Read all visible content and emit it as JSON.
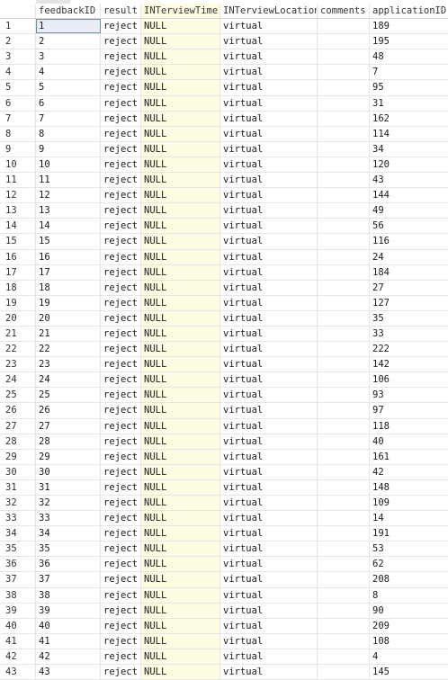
{
  "columns": [
    {
      "key": "rn",
      "label": ""
    },
    {
      "key": "feedbackID",
      "label": "feedbackID"
    },
    {
      "key": "result",
      "label": "result"
    },
    {
      "key": "INTerviewTime",
      "label": "INTerviewTime"
    },
    {
      "key": "INTerviewLocation",
      "label": "INTerviewLocation"
    },
    {
      "key": "comments",
      "label": "comments"
    },
    {
      "key": "applicationID",
      "label": "applicationID"
    }
  ],
  "selected_row": 1,
  "rows": [
    {
      "rn": "1",
      "feedbackID": "1",
      "result": "reject",
      "time": "NULL",
      "location": "virtual",
      "comments": "",
      "applicationID": "189"
    },
    {
      "rn": "2",
      "feedbackID": "2",
      "result": "reject",
      "time": "NULL",
      "location": "virtual",
      "comments": "",
      "applicationID": "195"
    },
    {
      "rn": "3",
      "feedbackID": "3",
      "result": "reject",
      "time": "NULL",
      "location": "virtual",
      "comments": "",
      "applicationID": "48"
    },
    {
      "rn": "4",
      "feedbackID": "4",
      "result": "reject",
      "time": "NULL",
      "location": "virtual",
      "comments": "",
      "applicationID": "7"
    },
    {
      "rn": "5",
      "feedbackID": "5",
      "result": "reject",
      "time": "NULL",
      "location": "virtual",
      "comments": "",
      "applicationID": "95"
    },
    {
      "rn": "6",
      "feedbackID": "6",
      "result": "reject",
      "time": "NULL",
      "location": "virtual",
      "comments": "",
      "applicationID": "31"
    },
    {
      "rn": "7",
      "feedbackID": "7",
      "result": "reject",
      "time": "NULL",
      "location": "virtual",
      "comments": "",
      "applicationID": "162"
    },
    {
      "rn": "8",
      "feedbackID": "8",
      "result": "reject",
      "time": "NULL",
      "location": "virtual",
      "comments": "",
      "applicationID": "114"
    },
    {
      "rn": "9",
      "feedbackID": "9",
      "result": "reject",
      "time": "NULL",
      "location": "virtual",
      "comments": "",
      "applicationID": "34"
    },
    {
      "rn": "10",
      "feedbackID": "10",
      "result": "reject",
      "time": "NULL",
      "location": "virtual",
      "comments": "",
      "applicationID": "120"
    },
    {
      "rn": "11",
      "feedbackID": "11",
      "result": "reject",
      "time": "NULL",
      "location": "virtual",
      "comments": "",
      "applicationID": "43"
    },
    {
      "rn": "12",
      "feedbackID": "12",
      "result": "reject",
      "time": "NULL",
      "location": "virtual",
      "comments": "",
      "applicationID": "144"
    },
    {
      "rn": "13",
      "feedbackID": "13",
      "result": "reject",
      "time": "NULL",
      "location": "virtual",
      "comments": "",
      "applicationID": "49"
    },
    {
      "rn": "14",
      "feedbackID": "14",
      "result": "reject",
      "time": "NULL",
      "location": "virtual",
      "comments": "",
      "applicationID": "56"
    },
    {
      "rn": "15",
      "feedbackID": "15",
      "result": "reject",
      "time": "NULL",
      "location": "virtual",
      "comments": "",
      "applicationID": "116"
    },
    {
      "rn": "16",
      "feedbackID": "16",
      "result": "reject",
      "time": "NULL",
      "location": "virtual",
      "comments": "",
      "applicationID": "24"
    },
    {
      "rn": "17",
      "feedbackID": "17",
      "result": "reject",
      "time": "NULL",
      "location": "virtual",
      "comments": "",
      "applicationID": "184"
    },
    {
      "rn": "18",
      "feedbackID": "18",
      "result": "reject",
      "time": "NULL",
      "location": "virtual",
      "comments": "",
      "applicationID": "27"
    },
    {
      "rn": "19",
      "feedbackID": "19",
      "result": "reject",
      "time": "NULL",
      "location": "virtual",
      "comments": "",
      "applicationID": "127"
    },
    {
      "rn": "20",
      "feedbackID": "20",
      "result": "reject",
      "time": "NULL",
      "location": "virtual",
      "comments": "",
      "applicationID": "35"
    },
    {
      "rn": "21",
      "feedbackID": "21",
      "result": "reject",
      "time": "NULL",
      "location": "virtual",
      "comments": "",
      "applicationID": "33"
    },
    {
      "rn": "22",
      "feedbackID": "22",
      "result": "reject",
      "time": "NULL",
      "location": "virtual",
      "comments": "",
      "applicationID": "222"
    },
    {
      "rn": "23",
      "feedbackID": "23",
      "result": "reject",
      "time": "NULL",
      "location": "virtual",
      "comments": "",
      "applicationID": "142"
    },
    {
      "rn": "24",
      "feedbackID": "24",
      "result": "reject",
      "time": "NULL",
      "location": "virtual",
      "comments": "",
      "applicationID": "106"
    },
    {
      "rn": "25",
      "feedbackID": "25",
      "result": "reject",
      "time": "NULL",
      "location": "virtual",
      "comments": "",
      "applicationID": "93"
    },
    {
      "rn": "26",
      "feedbackID": "26",
      "result": "reject",
      "time": "NULL",
      "location": "virtual",
      "comments": "",
      "applicationID": "97"
    },
    {
      "rn": "27",
      "feedbackID": "27",
      "result": "reject",
      "time": "NULL",
      "location": "virtual",
      "comments": "",
      "applicationID": "118"
    },
    {
      "rn": "28",
      "feedbackID": "28",
      "result": "reject",
      "time": "NULL",
      "location": "virtual",
      "comments": "",
      "applicationID": "40"
    },
    {
      "rn": "29",
      "feedbackID": "29",
      "result": "reject",
      "time": "NULL",
      "location": "virtual",
      "comments": "",
      "applicationID": "161"
    },
    {
      "rn": "30",
      "feedbackID": "30",
      "result": "reject",
      "time": "NULL",
      "location": "virtual",
      "comments": "",
      "applicationID": "42"
    },
    {
      "rn": "31",
      "feedbackID": "31",
      "result": "reject",
      "time": "NULL",
      "location": "virtual",
      "comments": "",
      "applicationID": "148"
    },
    {
      "rn": "32",
      "feedbackID": "32",
      "result": "reject",
      "time": "NULL",
      "location": "virtual",
      "comments": "",
      "applicationID": "109"
    },
    {
      "rn": "33",
      "feedbackID": "33",
      "result": "reject",
      "time": "NULL",
      "location": "virtual",
      "comments": "",
      "applicationID": "14"
    },
    {
      "rn": "34",
      "feedbackID": "34",
      "result": "reject",
      "time": "NULL",
      "location": "virtual",
      "comments": "",
      "applicationID": "191"
    },
    {
      "rn": "35",
      "feedbackID": "35",
      "result": "reject",
      "time": "NULL",
      "location": "virtual",
      "comments": "",
      "applicationID": "53"
    },
    {
      "rn": "36",
      "feedbackID": "36",
      "result": "reject",
      "time": "NULL",
      "location": "virtual",
      "comments": "",
      "applicationID": "62"
    },
    {
      "rn": "37",
      "feedbackID": "37",
      "result": "reject",
      "time": "NULL",
      "location": "virtual",
      "comments": "",
      "applicationID": "208"
    },
    {
      "rn": "38",
      "feedbackID": "38",
      "result": "reject",
      "time": "NULL",
      "location": "virtual",
      "comments": "",
      "applicationID": "8"
    },
    {
      "rn": "39",
      "feedbackID": "39",
      "result": "reject",
      "time": "NULL",
      "location": "virtual",
      "comments": "",
      "applicationID": "90"
    },
    {
      "rn": "40",
      "feedbackID": "40",
      "result": "reject",
      "time": "NULL",
      "location": "virtual",
      "comments": "",
      "applicationID": "209"
    },
    {
      "rn": "41",
      "feedbackID": "41",
      "result": "reject",
      "time": "NULL",
      "location": "virtual",
      "comments": "",
      "applicationID": "108"
    },
    {
      "rn": "42",
      "feedbackID": "42",
      "result": "reject",
      "time": "NULL",
      "location": "virtual",
      "comments": "",
      "applicationID": "4"
    },
    {
      "rn": "43",
      "feedbackID": "43",
      "result": "reject",
      "time": "NULL",
      "location": "virtual",
      "comments": "",
      "applicationID": "145"
    }
  ],
  "colors": {
    "null_column_bg": "#fffde1",
    "grid_line": "#e6e6e6",
    "selection_outline": "#7a8aa0"
  }
}
